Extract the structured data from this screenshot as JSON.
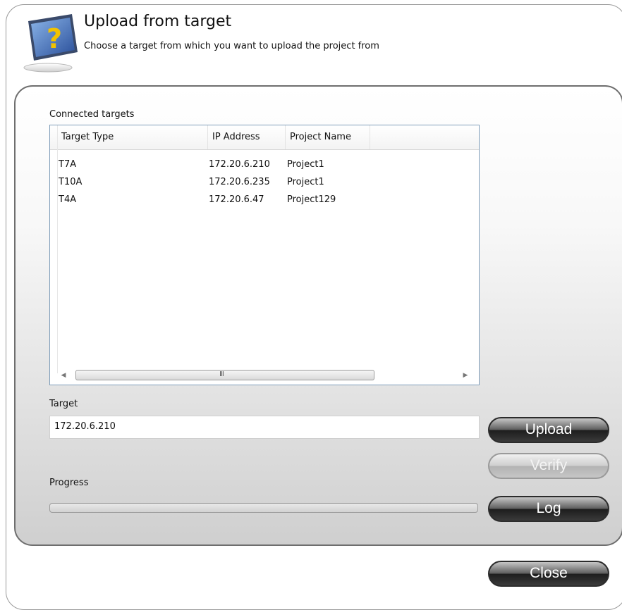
{
  "header": {
    "title": "Upload from target",
    "subtitle": "Choose a target from which you want to upload the project from"
  },
  "connected_targets": {
    "label": "Connected targets",
    "columns": [
      "Target Type",
      "IP Address",
      "Project Name"
    ],
    "rows": [
      {
        "target_type": "T7A",
        "ip_address": "172.20.6.210",
        "project_name": "Project1"
      },
      {
        "target_type": "T10A",
        "ip_address": "172.20.6.235",
        "project_name": "Project1"
      },
      {
        "target_type": "T4A",
        "ip_address": "172.20.6.47",
        "project_name": "Project129"
      }
    ],
    "scrollbar_grip": "III"
  },
  "target": {
    "label": "Target",
    "value": "172.20.6.210"
  },
  "progress": {
    "label": "Progress",
    "fraction": 0
  },
  "buttons": {
    "upload": "Upload",
    "verify": "Verify",
    "log": "Log",
    "close": "Close"
  },
  "icons": {
    "logo": "upload-help-icon",
    "scroll_left": "scroll-left-arrow-icon",
    "scroll_right": "scroll-right-arrow-icon"
  }
}
